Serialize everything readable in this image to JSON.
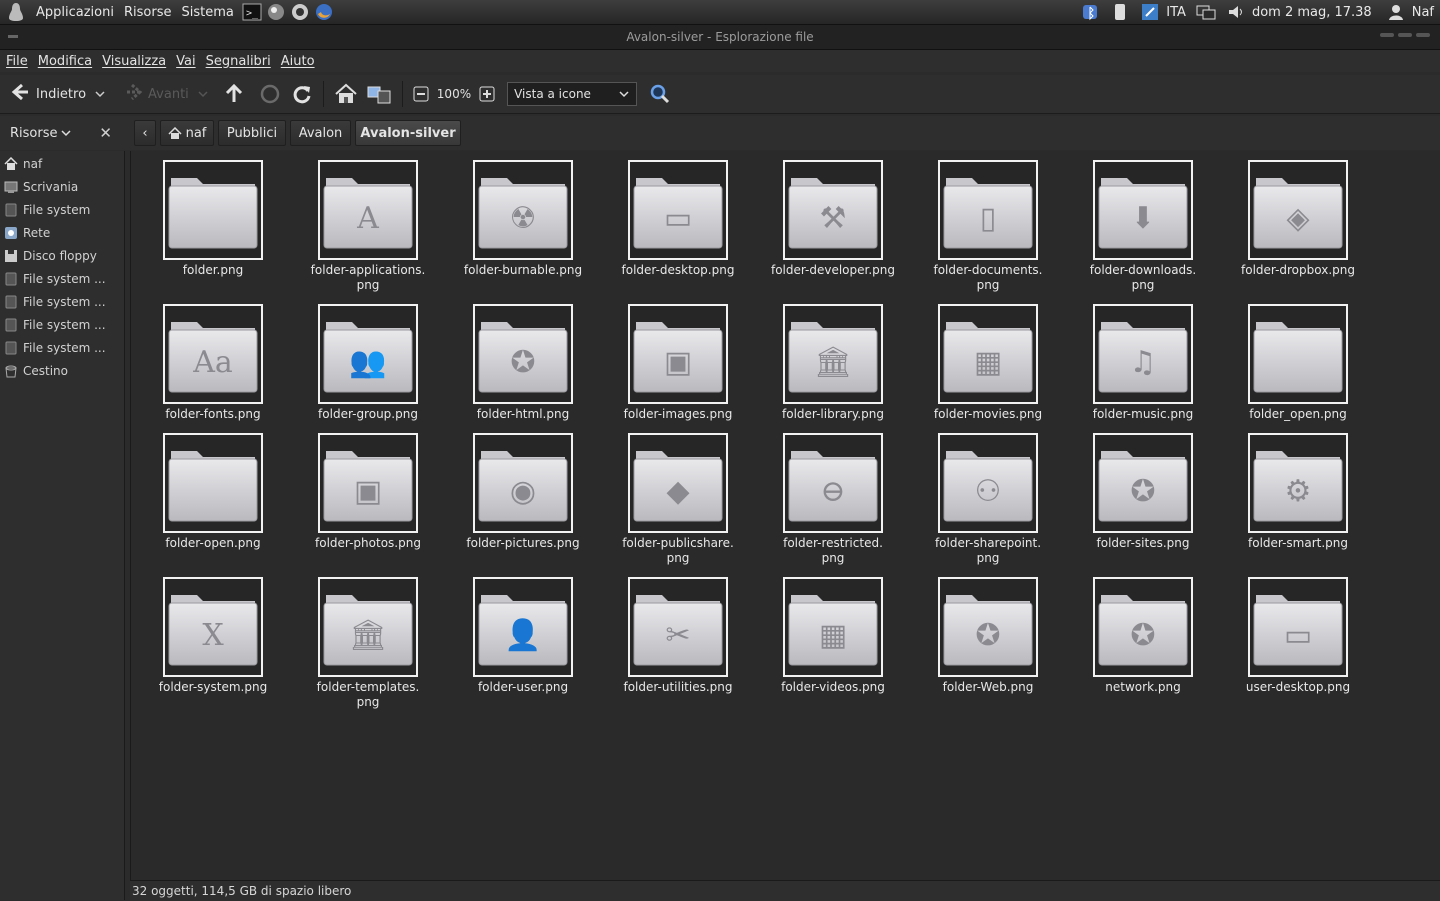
{
  "top_panel": {
    "menus": [
      "Applicazioni",
      "Risorse",
      "Sistema"
    ],
    "keyboard_layout": "ITA",
    "clock": "dom  2 mag, 17.38",
    "user": "Naf"
  },
  "window": {
    "title": "Avalon-silver - Esplorazione file"
  },
  "menubar": [
    "File",
    "Modifica",
    "Visualizza",
    "Vai",
    "Segnalibri",
    "Aiuto"
  ],
  "toolbar": {
    "back_label": "Indietro",
    "forward_label": "Avanti",
    "zoom_value": "100%",
    "view_mode": "Vista a icone"
  },
  "side_pane": {
    "header": "Risorse",
    "items": [
      {
        "label": "naf",
        "icon": "home-icon"
      },
      {
        "label": "Scrivania",
        "icon": "desktop-icon"
      },
      {
        "label": "File system",
        "icon": "drive-icon"
      },
      {
        "label": "Rete",
        "icon": "network-icon"
      },
      {
        "label": "Disco floppy",
        "icon": "floppy-icon"
      },
      {
        "label": "File system ...",
        "icon": "drive-icon"
      },
      {
        "label": "File system ...",
        "icon": "drive-icon"
      },
      {
        "label": "File system ...",
        "icon": "drive-icon"
      },
      {
        "label": "File system ...",
        "icon": "drive-icon"
      },
      {
        "label": "Cestino",
        "icon": "trash-icon"
      }
    ]
  },
  "breadcrumbs": [
    "naf",
    "Pubblici",
    "Avalon",
    "Avalon-silver"
  ],
  "files": [
    {
      "name": "folder.png",
      "glyph": ""
    },
    {
      "name": "folder-applications.\npng",
      "glyph": "A"
    },
    {
      "name": "folder-burnable.png",
      "glyph": "☢"
    },
    {
      "name": "folder-desktop.png",
      "glyph": "▭"
    },
    {
      "name": "folder-developer.png",
      "glyph": "⚒"
    },
    {
      "name": "folder-documents.\npng",
      "glyph": "▯"
    },
    {
      "name": "folder-downloads.\npng",
      "glyph": "⬇"
    },
    {
      "name": "folder-dropbox.png",
      "glyph": "◈"
    },
    {
      "name": "folder-fonts.png",
      "glyph": "Aa"
    },
    {
      "name": "folder-group.png",
      "glyph": "👥"
    },
    {
      "name": "folder-html.png",
      "glyph": "✪"
    },
    {
      "name": "folder-images.png",
      "glyph": "▣"
    },
    {
      "name": "folder-library.png",
      "glyph": "🏛"
    },
    {
      "name": "folder-movies.png",
      "glyph": "▦"
    },
    {
      "name": "folder-music.png",
      "glyph": "♫"
    },
    {
      "name": "folder_open.png",
      "glyph": ""
    },
    {
      "name": "folder-open.png",
      "glyph": ""
    },
    {
      "name": "folder-photos.png",
      "glyph": "▣"
    },
    {
      "name": "folder-pictures.png",
      "glyph": "◉"
    },
    {
      "name": "folder-publicshare.\npng",
      "glyph": "◆"
    },
    {
      "name": "folder-restricted.\npng",
      "glyph": "⊖"
    },
    {
      "name": "folder-sharepoint.\npng",
      "glyph": "⚇"
    },
    {
      "name": "folder-sites.png",
      "glyph": "✪"
    },
    {
      "name": "folder-smart.png",
      "glyph": "⚙"
    },
    {
      "name": "folder-system.png",
      "glyph": "X"
    },
    {
      "name": "folder-templates.\npng",
      "glyph": "🏛"
    },
    {
      "name": "folder-user.png",
      "glyph": "👤"
    },
    {
      "name": "folder-utilities.png",
      "glyph": "✂"
    },
    {
      "name": "folder-videos.png",
      "glyph": "▦"
    },
    {
      "name": "folder-Web.png",
      "glyph": "✪"
    },
    {
      "name": "network.png",
      "glyph": "✪"
    },
    {
      "name": "user-desktop.png",
      "glyph": "▭"
    }
  ],
  "statusbar": "32 oggetti, 114,5 GB di spazio libero"
}
